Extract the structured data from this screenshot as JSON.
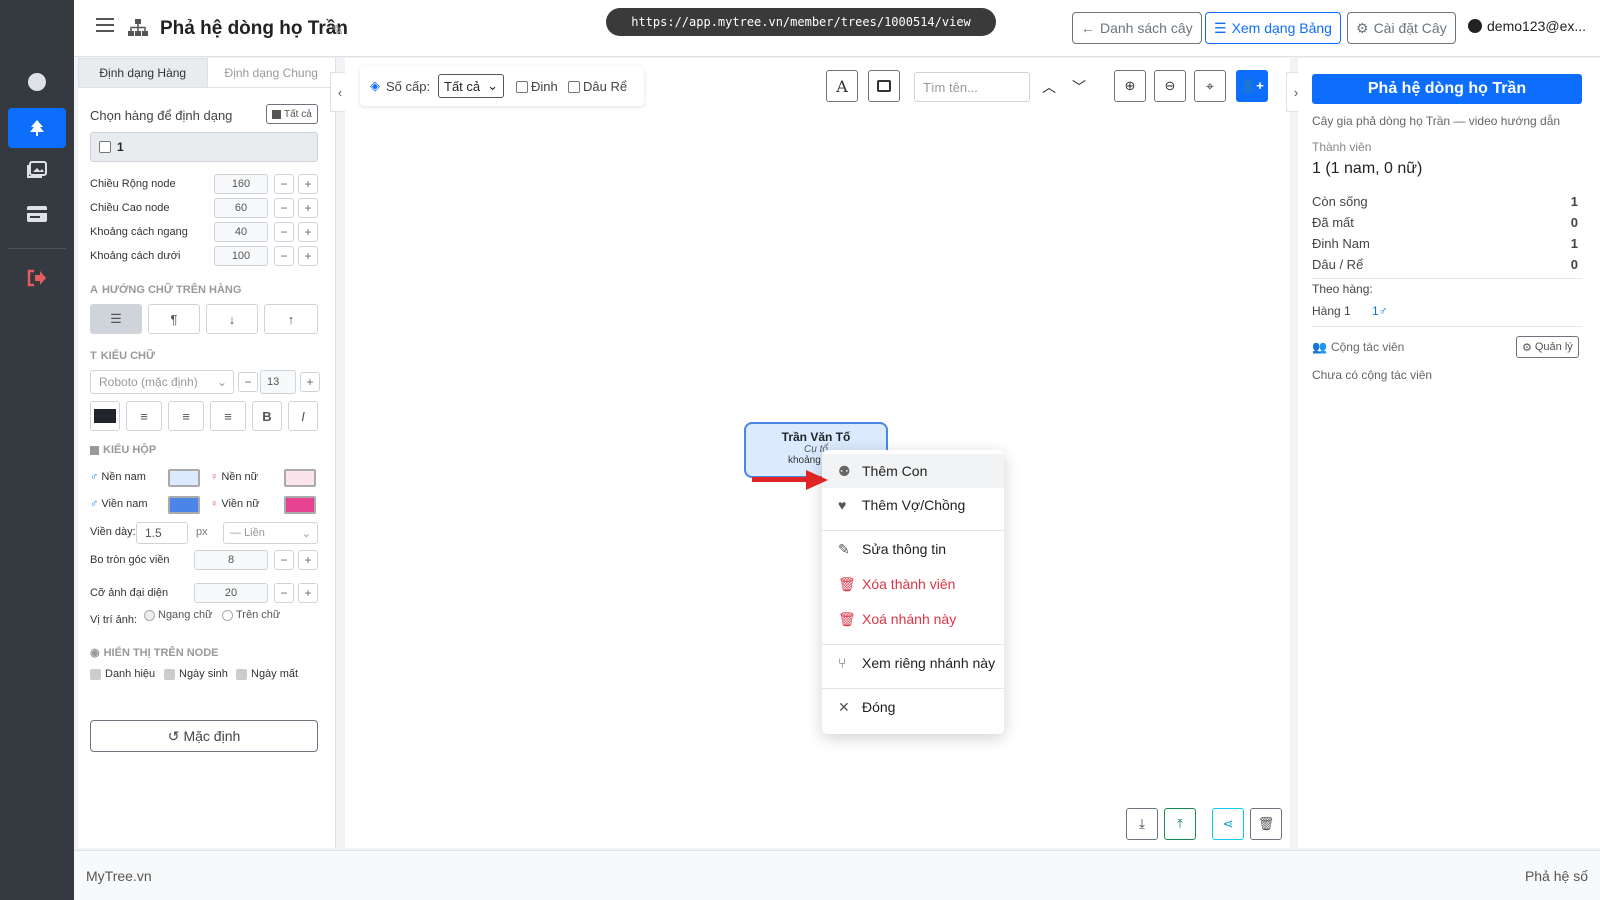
{
  "header": {
    "title": "Phả hệ dòng họ Trần",
    "url": "https://app.mytree.vn/member/trees/1000514/view",
    "btn_list": "Danh sách cây",
    "btn_table": "Xem dạng Bảng",
    "btn_settings": "Cài đặt Cây",
    "user": "demo123@ex..."
  },
  "left": {
    "tab_row": "Định dạng Hàng",
    "tab_general": "Định dạng Chung",
    "select_label": "Chọn hàng để định dạng",
    "select_all": "Tất cả",
    "row_item": "1",
    "fields": [
      {
        "label": "Chiều Rộng node",
        "value": "160"
      },
      {
        "label": "Chiều Cao node",
        "value": "60"
      },
      {
        "label": "Khoảng cách ngang",
        "value": "40"
      },
      {
        "label": "Khoảng cách dưới",
        "value": "100"
      }
    ],
    "sec_direction": "HƯỚNG CHỮ TRÊN HÀNG",
    "sec_font": "KIỂU CHỮ",
    "font_name": "Roboto (mặc định)",
    "font_size": "13",
    "sec_box": "KIỂU HỘP",
    "bg_male": "Nền nam",
    "bg_female": "Nền nữ",
    "border_male": "Viền nam",
    "border_female": "Viền nữ",
    "border_width_label": "Viền dày:",
    "border_width": "1.5",
    "px": "px",
    "border_style": "— Liền",
    "radius_label": "Bo tròn góc viền",
    "radius": "8",
    "avatar_label": "Cỡ ảnh đại diện",
    "avatar": "20",
    "img_pos_label": "Vị trí ảnh:",
    "img_pos_1": "Ngang chữ",
    "img_pos_2": "Trên chữ",
    "sec_display": "HIỂN THỊ TRÊN NODE",
    "show_title": "Danh hiệu",
    "show_birth": "Ngày sinh",
    "show_death": "Ngày mất",
    "reset": "Mặc định",
    "colors": {
      "bg_male": "#dbeafe",
      "bg_female": "#fce4ec",
      "border_male": "#4a86e8",
      "border_female": "#e84393",
      "text": "#212529"
    }
  },
  "toolbar": {
    "level_label": "Số cấp:",
    "level_value": "Tất cả",
    "chk_dinh": "Đinh",
    "chk_dau": "Dâu Rể",
    "search_ph": "Tìm tên..."
  },
  "node": {
    "name": "Trần Văn Tố",
    "title": "Cụ tổ",
    "line3": "khoảng"
  },
  "menu": {
    "add_child": "Thêm Con",
    "add_spouse": "Thêm Vợ/Chồng",
    "edit": "Sửa thông tin",
    "delete_member": "Xóa thành viên",
    "delete_branch": "Xoá nhánh này",
    "view_branch": "Xem riêng nhánh này",
    "close": "Đóng"
  },
  "right": {
    "title": "Phả hệ dòng họ Trần",
    "desc": "Cây gia phả dòng họ Trần — video hướng dẫn",
    "members_label": "Thành viên",
    "members": "1 (1 nam, 0 nữ)",
    "stats": [
      {
        "label": "Còn sống",
        "value": "1"
      },
      {
        "label": "Đã mất",
        "value": "0"
      },
      {
        "label": "Đinh Nam",
        "value": "1"
      },
      {
        "label": "Dâu / Rể",
        "value": "0"
      }
    ],
    "by_row": "Theo hàng:",
    "row1_label": "Hàng 1",
    "row1_value": "1♂",
    "collab": "Cộng tác viên",
    "manage": "Quản lý",
    "no_collab": "Chưa có cộng tác viên"
  },
  "footer": {
    "left": "MyTree.vn",
    "right": "Phả hệ số"
  }
}
